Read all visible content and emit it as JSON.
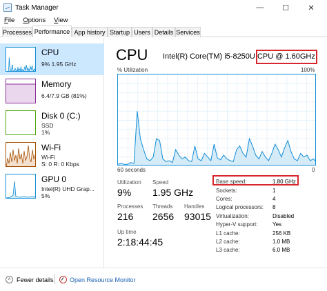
{
  "window": {
    "title": "Task Manager",
    "minimize": "—",
    "maximize": "☐",
    "close": "✕"
  },
  "menu": [
    {
      "mnemonic": "F",
      "rest": "ile"
    },
    {
      "mnemonic": "O",
      "rest": "ptions"
    },
    {
      "mnemonic": "V",
      "rest": "iew"
    }
  ],
  "tabs": [
    "Processes",
    "Performance",
    "App history",
    "Startup",
    "Users",
    "Details",
    "Services"
  ],
  "sidebar": {
    "items": [
      {
        "name": "CPU",
        "sub1": "9%  1.95 GHz",
        "sub2": "",
        "sub3": ""
      },
      {
        "name": "Memory",
        "sub1": "6.4/7.9 GB (81%)",
        "sub2": "",
        "sub3": ""
      },
      {
        "name": "Disk 0 (C:)",
        "sub1": "SSD",
        "sub2": "1%",
        "sub3": ""
      },
      {
        "name": "Wi-Fi",
        "sub1": "Wi-Fi",
        "sub2": "S: 0  R: 0 Kbps",
        "sub3": ""
      },
      {
        "name": "GPU 0",
        "sub1": "Intel(R) UHD Grap...",
        "sub2": "5%",
        "sub3": ""
      }
    ]
  },
  "main": {
    "title": "CPU",
    "model_prefix": "Intel(R) Core(TM) i5-8250U",
    "model_speed": "CPU @ 1.60GHz",
    "graph_ylabel": "% Utilization",
    "graph_ymax": "100%",
    "graph_xlabel": "60 seconds",
    "graph_ymin": "0",
    "utilization_label": "Utilization",
    "utilization_value": "9%",
    "speed_label": "Speed",
    "speed_value": "1.95 GHz",
    "processes_label": "Processes",
    "processes_value": "216",
    "threads_label": "Threads",
    "threads_value": "2656",
    "handles_label": "Handles",
    "handles_value": "93015",
    "uptime_label": "Up time",
    "uptime_value": "2:18:44:45",
    "specs": [
      {
        "label": "Base speed:",
        "value": "1.80 GHz"
      },
      {
        "label": "Sockets:",
        "value": "1"
      },
      {
        "label": "Cores:",
        "value": "4"
      },
      {
        "label": "Logical processors:",
        "value": "8"
      },
      {
        "label": "Virtualization:",
        "value": "Disabled"
      },
      {
        "label": "Hyper-V support:",
        "value": "Yes"
      },
      {
        "label": "L1 cache:",
        "value": "256 KB"
      },
      {
        "label": "L2 cache:",
        "value": "1.0 MB"
      },
      {
        "label": "L3 cache:",
        "value": "6.0 MB"
      }
    ]
  },
  "footer": {
    "fewer_details": "Fewer details",
    "open_resmon": "Open Resource Monitor"
  },
  "colors": {
    "cpu_line": "#118dd6",
    "cpu_fill": "#d5ebf8",
    "mem_line": "#8b2f96",
    "mem_fill": "#ead7ee",
    "disk_line": "#4da60c",
    "disk_fill": "#e2f1d5",
    "wifi_line": "#a74f01",
    "wifi_fill": "#f3e0ce",
    "highlight": "#d8262d"
  },
  "cpu_history": [
    2,
    3,
    2,
    2,
    4,
    3,
    60,
    30,
    18,
    8,
    6,
    10,
    30,
    28,
    8,
    5,
    6,
    4,
    18,
    12,
    8,
    10,
    6,
    5,
    22,
    8,
    6,
    14,
    10,
    6,
    24,
    9,
    7,
    12,
    8,
    6,
    5,
    18,
    22,
    14,
    10,
    30,
    22,
    12,
    8,
    16,
    10,
    6,
    14,
    24,
    18,
    10,
    20,
    28,
    16,
    8,
    6,
    14,
    10,
    12,
    6,
    8,
    4
  ]
}
